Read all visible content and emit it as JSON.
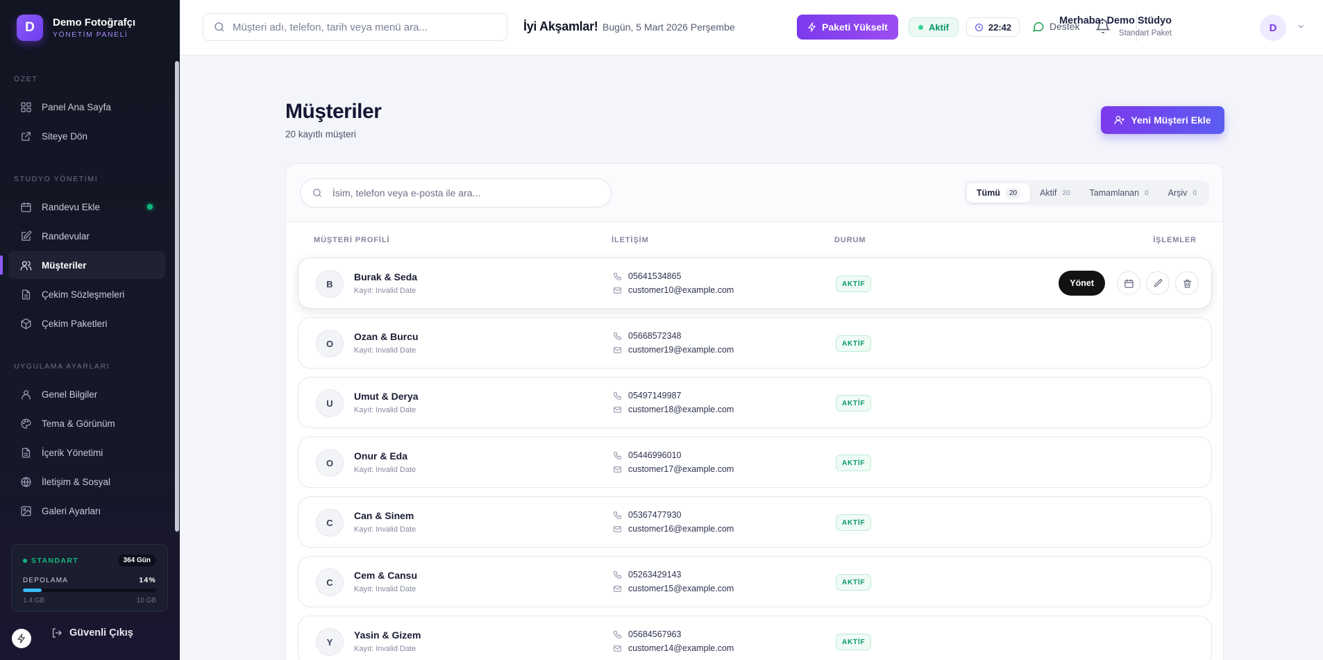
{
  "brand": {
    "initial": "D",
    "name": "Demo Fotoğrafçı",
    "subtitle": "YÖNETİM PANELİ"
  },
  "sidebar": {
    "sections": [
      {
        "label": "ÖZET",
        "items": [
          {
            "label": "Panel Ana Sayfa",
            "icon": "dashboard-icon"
          },
          {
            "label": "Siteye Dön",
            "icon": "external-link-icon"
          }
        ]
      },
      {
        "label": "STUDYO YÖNETİMİ",
        "items": [
          {
            "label": "Randevu Ekle",
            "icon": "calendar-icon",
            "dot": true
          },
          {
            "label": "Randevular",
            "icon": "edit-icon"
          },
          {
            "label": "Müşteriler",
            "icon": "users-icon",
            "active": true
          },
          {
            "label": "Çekim Sözleşmeleri",
            "icon": "document-icon"
          },
          {
            "label": "Çekim Paketleri",
            "icon": "package-icon"
          }
        ]
      },
      {
        "label": "UYGULAMA AYARLARI",
        "items": [
          {
            "label": "Genel Bilgiler",
            "icon": "user-icon"
          },
          {
            "label": "Tema & Görünüm",
            "icon": "palette-icon"
          },
          {
            "label": "İçerik Yönetimi",
            "icon": "document-icon"
          },
          {
            "label": "İletişim & Sosyal",
            "icon": "globe-icon"
          },
          {
            "label": "Galeri Ayarları",
            "icon": "image-icon"
          }
        ]
      }
    ],
    "plan": {
      "name": "STANDART",
      "days": "364 Gün",
      "storage_label": "DEPOLAMA",
      "storage_pct": "14%",
      "storage_fraction": 0.14,
      "used": "1.4 GB",
      "total": "10 GB"
    },
    "logout_label": "Güvenli Çıkış"
  },
  "topbar": {
    "search_placeholder": "Müşteri adı, telefon, tarih veya menü ara...",
    "greeting": "İyi Akşamlar!",
    "date": "Bugün, 5 Mart 2026 Perşembe",
    "upgrade_label": "Paketi Yükselt",
    "status_label": "Aktif",
    "time": "22:42",
    "support_label": "Destek",
    "user_name": "Merhaba: Demo Stüdyo",
    "user_plan": "Standart Paket",
    "avatar_initial": "D"
  },
  "main": {
    "title": "Müşteriler",
    "subtitle": "20 kayıtlı müşteri",
    "add_label": "Yeni Müşteri Ekle",
    "search_placeholder": "İsim, telefon veya e-posta ile ara...",
    "filters": [
      {
        "label": "Tümü",
        "count": "20",
        "active": true
      },
      {
        "label": "Aktif",
        "count": "20"
      },
      {
        "label": "Tamamlanan",
        "count": "0"
      },
      {
        "label": "Arşiv",
        "count": "0"
      }
    ],
    "columns": {
      "profile": "MÜŞTERİ PROFİLİ",
      "contact": "İLETİŞİM",
      "status": "DURUM",
      "actions": "İŞLEMLER"
    },
    "manage_label": "Yönet",
    "customers": [
      {
        "initial": "B",
        "name": "Burak & Seda",
        "registered": "Kayıt: Invalid Date",
        "phone": "05641534865",
        "email": "customer10@example.com",
        "status": "AKTİF"
      },
      {
        "initial": "O",
        "name": "Ozan & Burcu",
        "registered": "Kayıt: Invalid Date",
        "phone": "05668572348",
        "email": "customer19@example.com",
        "status": "AKTİF"
      },
      {
        "initial": "U",
        "name": "Umut & Derya",
        "registered": "Kayıt: Invalid Date",
        "phone": "05497149987",
        "email": "customer18@example.com",
        "status": "AKTİF"
      },
      {
        "initial": "O",
        "name": "Onur & Eda",
        "registered": "Kayıt: Invalid Date",
        "phone": "05446996010",
        "email": "customer17@example.com",
        "status": "AKTİF"
      },
      {
        "initial": "C",
        "name": "Can & Sinem",
        "registered": "Kayıt: Invalid Date",
        "phone": "05367477930",
        "email": "customer16@example.com",
        "status": "AKTİF"
      },
      {
        "initial": "C",
        "name": "Cem & Cansu",
        "registered": "Kayıt: Invalid Date",
        "phone": "05263429143",
        "email": "customer15@example.com",
        "status": "AKTİF"
      },
      {
        "initial": "Y",
        "name": "Yasin & Gizem",
        "registered": "Kayıt: Invalid Date",
        "phone": "05684567963",
        "email": "customer14@example.com",
        "status": "AKTİF"
      }
    ]
  }
}
